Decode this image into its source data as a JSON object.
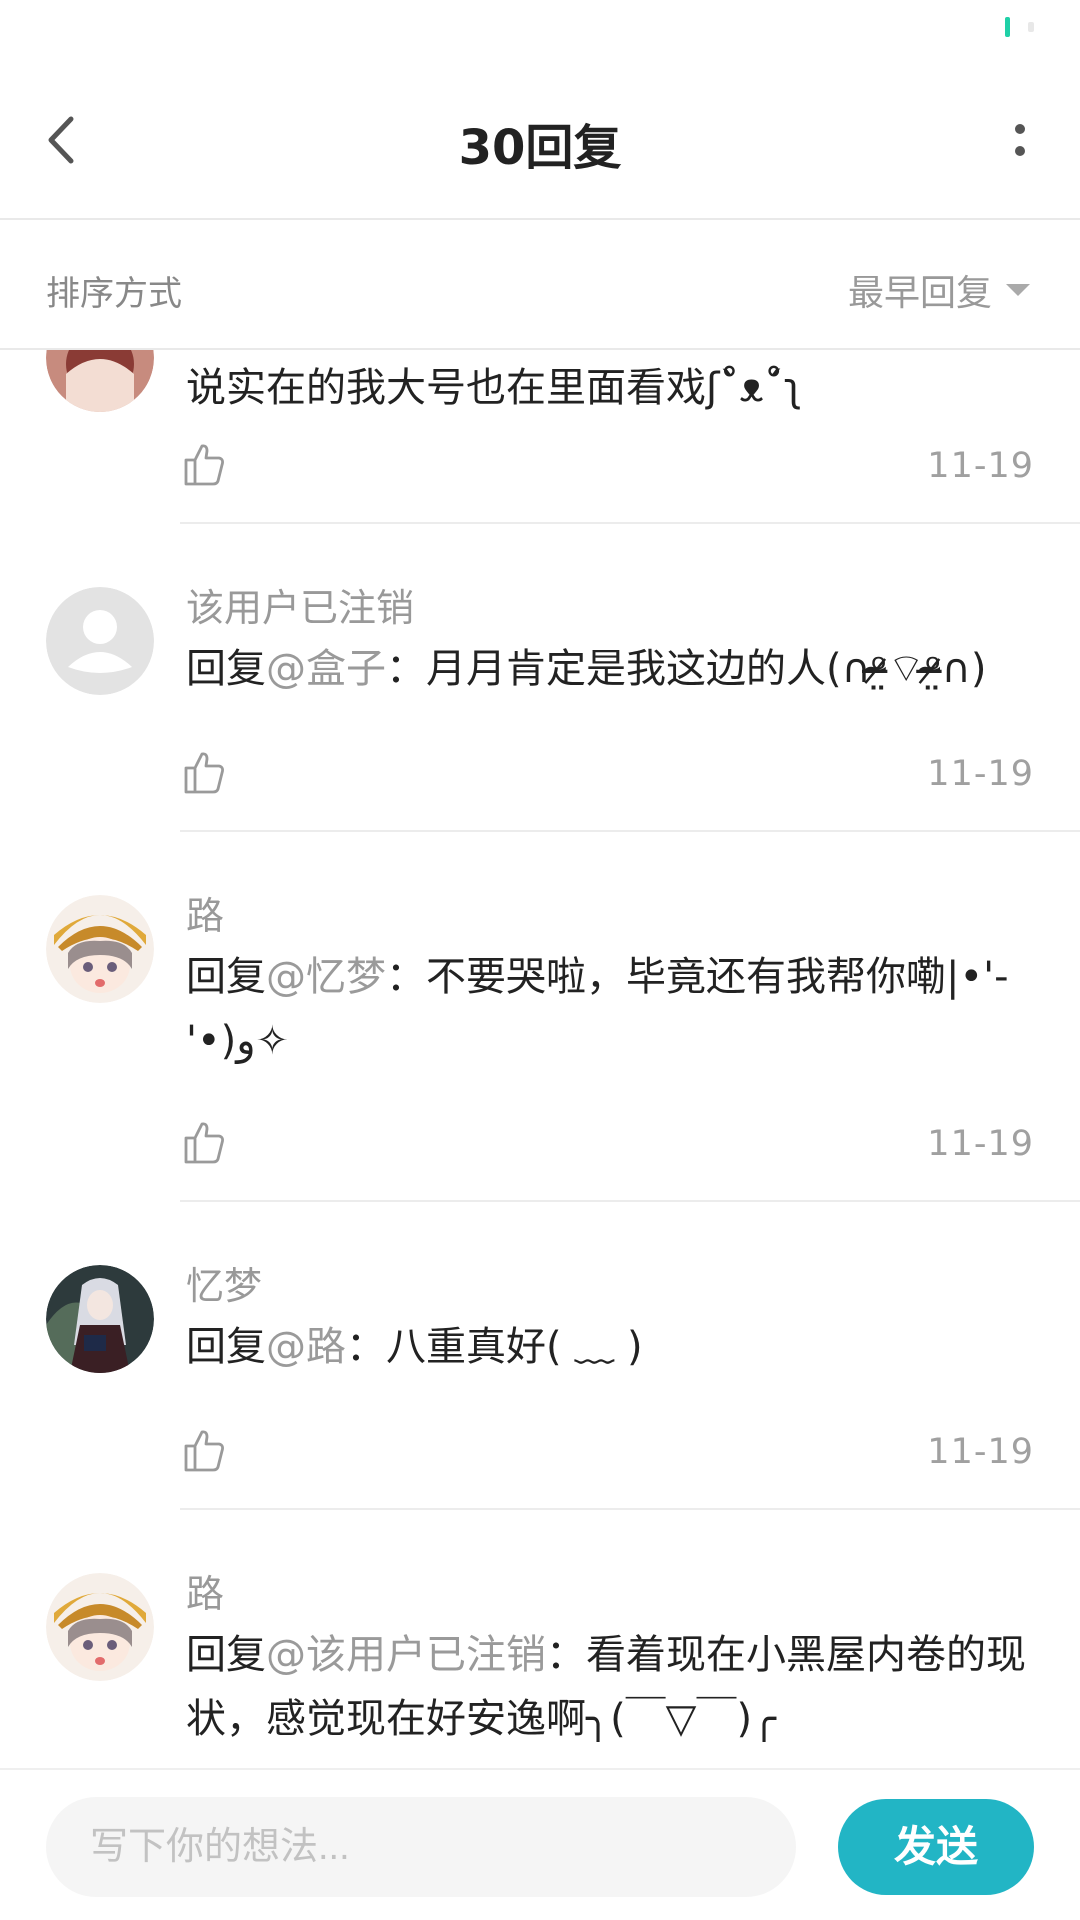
{
  "colors": {
    "accent": "#22b5c5",
    "status_indicator": "#1fd0a7"
  },
  "header": {
    "title": "30回复",
    "back_icon": "chevron-left-icon",
    "more_icon": "more-vertical-icon"
  },
  "sort": {
    "label": "排序方式",
    "selected": "最早回复"
  },
  "replies": [
    {
      "username": "",
      "reply_prefix": "",
      "mention": "",
      "text": "说实在的我大号也在里面看戏ʃ˚̀ᴥ˚́ʅ",
      "date": "11-19",
      "avatar": "anime-avatar-partial"
    },
    {
      "username": "该用户已注销",
      "reply_prefix": "回复",
      "mention": "@盒子",
      "text": "：月月肯定是我这边的人(∩ᵒ̴̶̷̤⌔ᵒ̴̶̷̤∩)",
      "date": "11-19",
      "avatar": "default-user-avatar"
    },
    {
      "username": "路",
      "reply_prefix": "回复",
      "mention": "@忆梦",
      "text": "：不要哭啦，毕竟还有我帮你嘞|•'-'•)و✧",
      "date": "11-19",
      "avatar": "anime-avatar-yellow-hat"
    },
    {
      "username": "忆梦",
      "reply_prefix": "回复",
      "mention": "@路",
      "text": "：八重真好( ﹏ )",
      "date": "11-19",
      "avatar": "anime-avatar-silver-hair"
    },
    {
      "username": "路",
      "reply_prefix": "回复",
      "mention": "@该用户已注销",
      "text": "：看着现在小黑屋内卷的现状，感觉现在好安逸啊╮(￣▽￣)╭",
      "date": "",
      "avatar": "anime-avatar-yellow-hat"
    }
  ],
  "composer": {
    "placeholder": "写下你的想法...",
    "send_label": "发送"
  }
}
